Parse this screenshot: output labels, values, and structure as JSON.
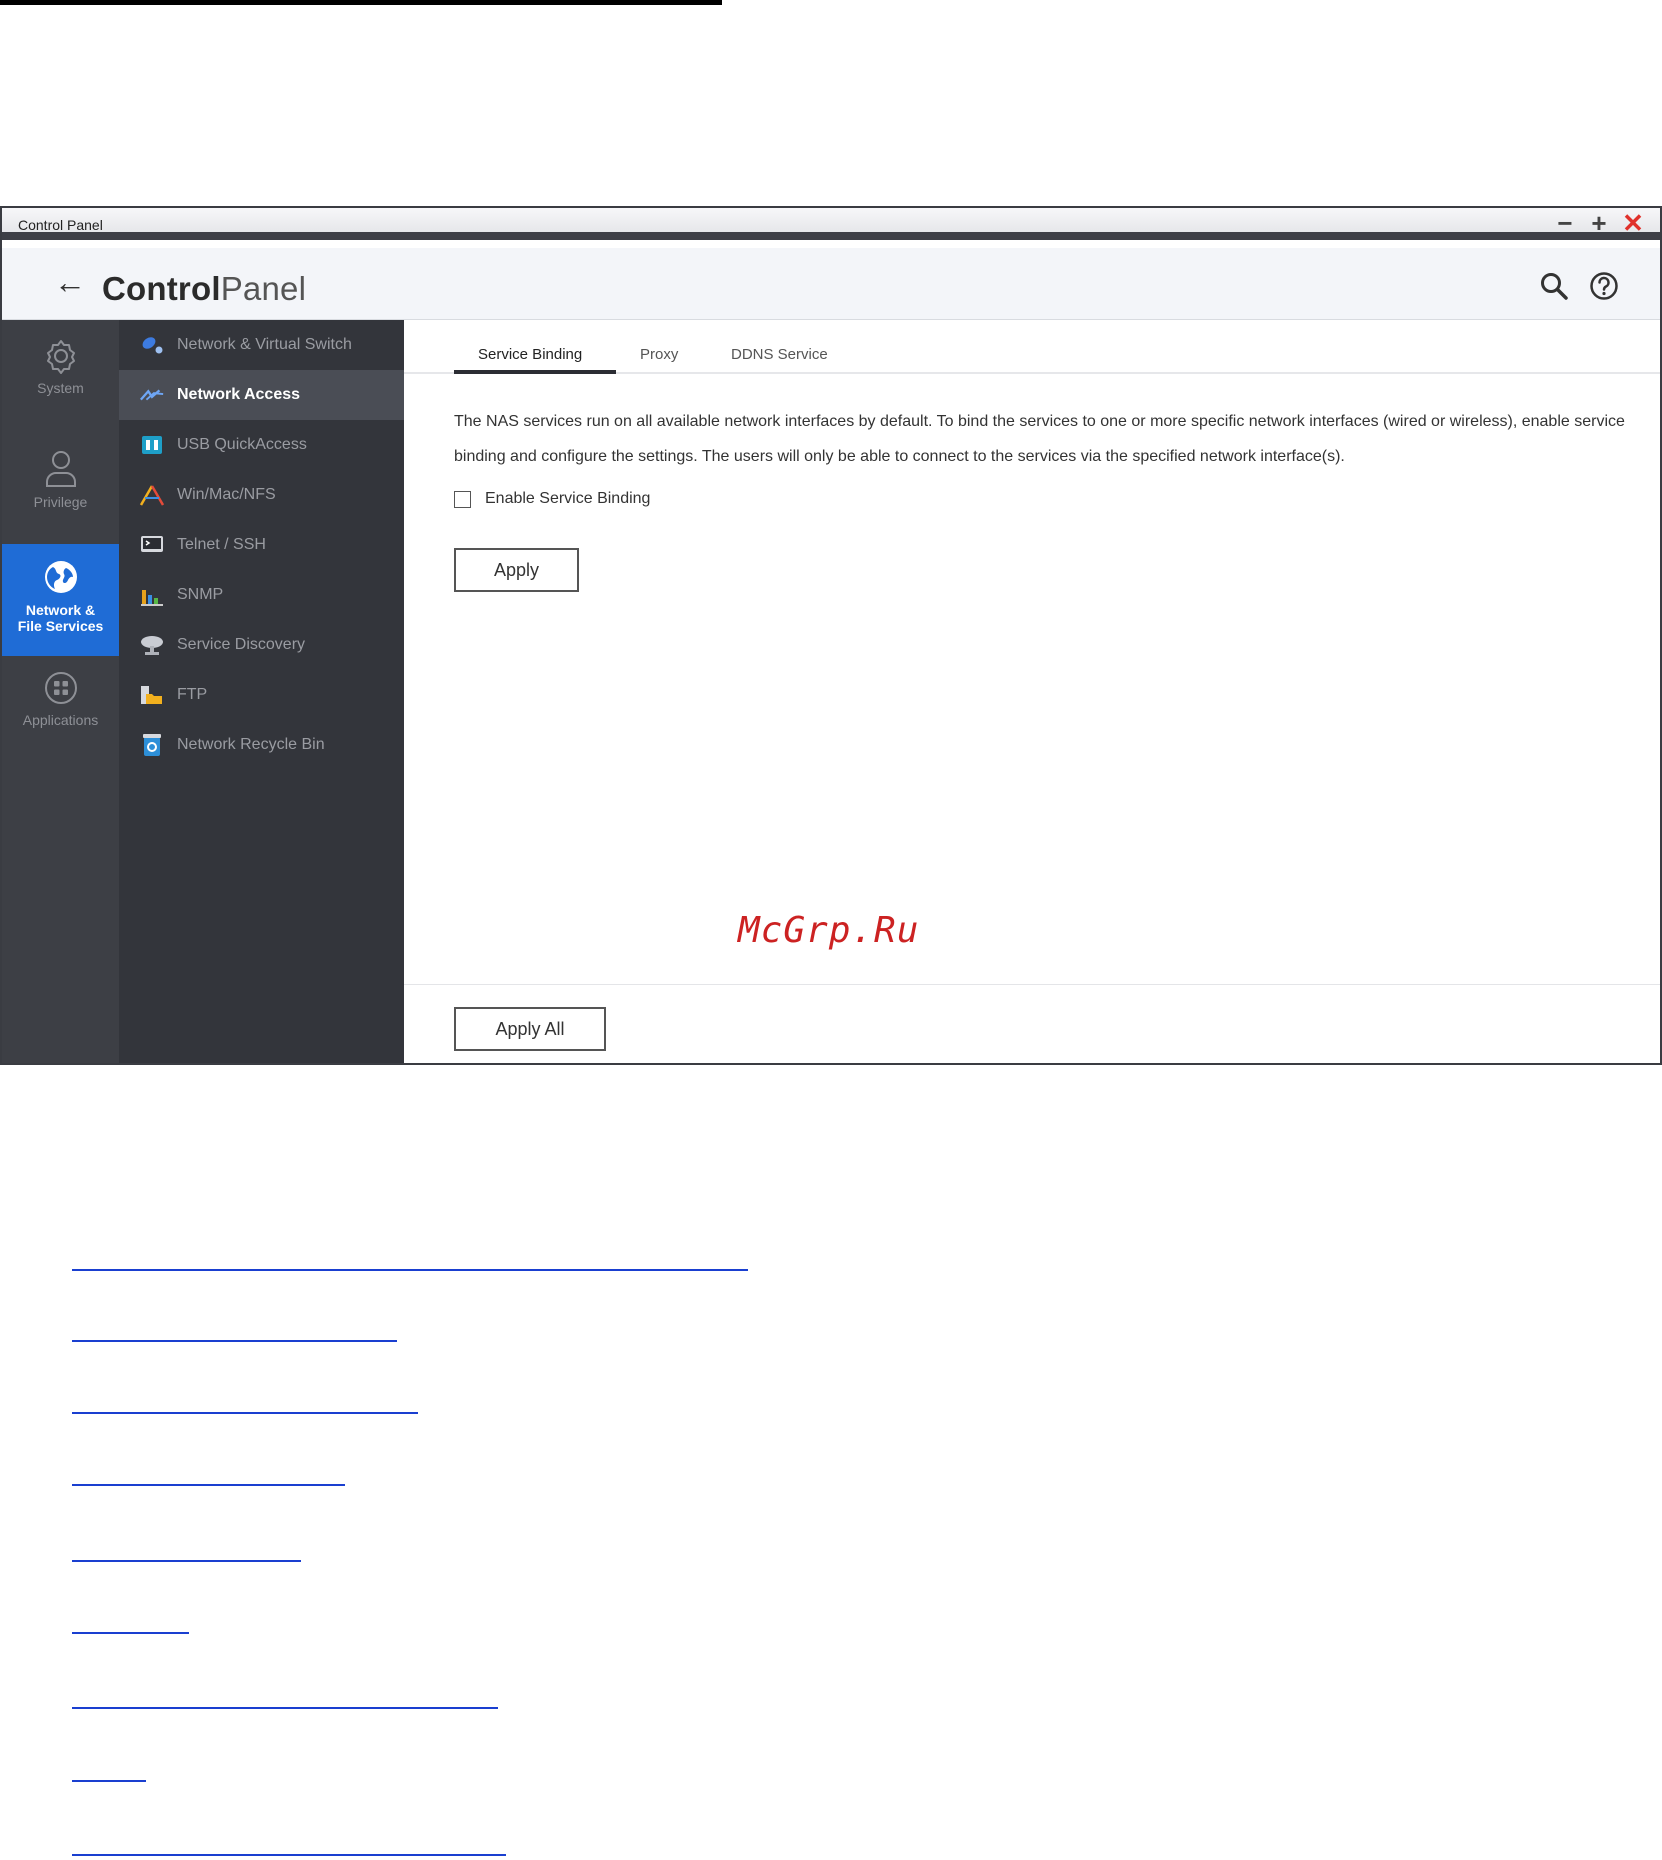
{
  "window": {
    "title": "Control Panel",
    "controls": {
      "minimize": "−",
      "maximize": "+",
      "close": "✕"
    }
  },
  "header": {
    "title_bold": "Control",
    "title_light": "Panel",
    "icons": [
      "back-arrow-icon",
      "search-icon",
      "help-icon"
    ]
  },
  "rail": {
    "items": [
      {
        "label": "System",
        "icon": "gear-icon"
      },
      {
        "label": "Privilege",
        "icon": "user-icon"
      },
      {
        "label_line1": "Network &",
        "label_line2": "File Services",
        "icon": "globe-icon",
        "active": true
      },
      {
        "label": "Applications",
        "icon": "grid-icon"
      }
    ]
  },
  "submenu": {
    "items": [
      {
        "label": "Network & Virtual Switch",
        "icon": "network-switch-icon"
      },
      {
        "label": "Network Access",
        "icon": "network-access-icon",
        "active": true
      },
      {
        "label": "USB QuickAccess",
        "icon": "usb-icon"
      },
      {
        "label": "Win/Mac/NFS",
        "icon": "win-mac-nfs-icon"
      },
      {
        "label": "Telnet / SSH",
        "icon": "terminal-icon"
      },
      {
        "label": "SNMP",
        "icon": "snmp-chart-icon"
      },
      {
        "label": "Service Discovery",
        "icon": "discovery-icon"
      },
      {
        "label": "FTP",
        "icon": "ftp-folder-icon"
      },
      {
        "label": "Network Recycle Bin",
        "icon": "recycle-bin-icon"
      }
    ]
  },
  "tabs": [
    {
      "label": "Service Binding",
      "active": true
    },
    {
      "label": "Proxy"
    },
    {
      "label": "DDNS Service"
    }
  ],
  "main": {
    "description": "The NAS services run on all available network interfaces by default. To bind the services to one or more specific network interfaces (wired or wireless), enable service binding and configure the settings. The users will only be able to connect to the services via the specified network interface(s).",
    "checkbox_label": "Enable Service Binding",
    "checkbox_checked": false,
    "apply_label": "Apply",
    "apply_all_label": "Apply All"
  },
  "watermark": "McGrp.Ru",
  "colors": {
    "rail_bg": "#3d3f45",
    "submenu_bg": "#33353b",
    "active_rail": "#1f6cd6",
    "close": "#e0312b",
    "link_line": "#1a3fd0"
  }
}
